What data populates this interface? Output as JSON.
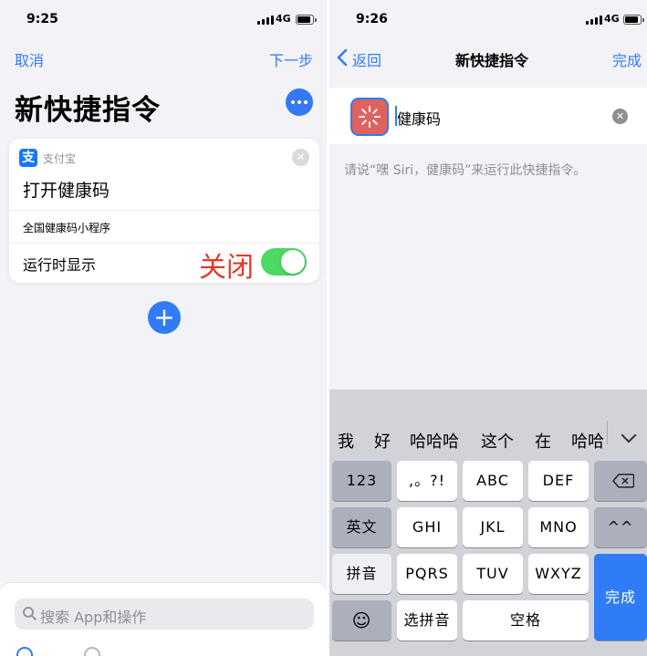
{
  "left": {
    "status": {
      "time": "9:25",
      "network": "4G"
    },
    "nav": {
      "cancel": "取消",
      "next": "下一步"
    },
    "title": "新快捷指令",
    "card": {
      "app_icon": "支",
      "app_name": "支付宝",
      "action_title": "打开健康码",
      "param": "全国健康码小程序",
      "show_label": "运行时显示",
      "annotation": "关闭"
    },
    "add_symbol": "+",
    "search_placeholder": "搜索 App和操作"
  },
  "right": {
    "status": {
      "time": "9:26",
      "network": "4G"
    },
    "nav": {
      "back": "返回",
      "title": "新快捷指令",
      "done": "完成"
    },
    "shortcut_name": "健康码",
    "hint": "请说“嘿 Siri，健康码”来运行此快捷指令。"
  },
  "keyboard": {
    "candidates": [
      "我",
      "好",
      "哈哈哈",
      "这个",
      "在",
      "哈哈"
    ],
    "keys": {
      "num": "123",
      "punct": ",。?!",
      "abc": "ABC",
      "def": "DEF",
      "english": "英文",
      "ghi": "GHI",
      "jkl": "JKL",
      "mno": "MNO",
      "face": "^^",
      "pinyin": "拼音",
      "pqrs": "PQRS",
      "tuv": "TUV",
      "wxyz": "WXYZ",
      "done": "完成",
      "emoji": "☺",
      "select_pinyin": "选拼音",
      "space": "空格"
    }
  },
  "colors": {
    "accent": "#2f7cf6",
    "toggle_on": "#4cd964",
    "annotation": "#e03a2c",
    "shortcut_icon": "#e0625f"
  },
  "icons": [
    "signal-icon",
    "battery-icon",
    "more-icon",
    "alipay-icon",
    "close-icon",
    "plus-icon",
    "search-icon",
    "back-chevron-icon",
    "loading-icon",
    "clear-icon",
    "chevron-down-icon",
    "delete-icon"
  ]
}
